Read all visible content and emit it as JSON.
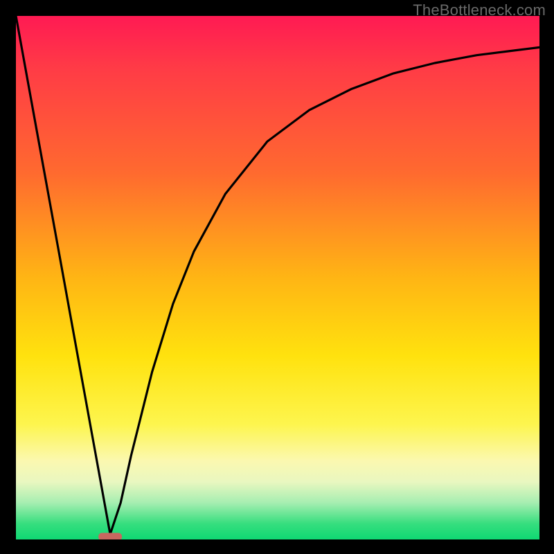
{
  "watermark": "TheBottleneck.com",
  "chart_data": {
    "type": "line",
    "title": "",
    "xlabel": "",
    "ylabel": "",
    "xlim": [
      0,
      100
    ],
    "ylim": [
      0,
      100
    ],
    "curve": {
      "description": "V-shaped curve: steep linear descent from top-left to a minimum near x≈18, then a concave-up rise approaching the top-right asymptotically",
      "x": [
        0,
        4,
        8,
        12,
        16,
        18,
        20,
        22,
        26,
        30,
        34,
        40,
        48,
        56,
        64,
        72,
        80,
        88,
        96,
        100
      ],
      "y": [
        100,
        78,
        56,
        34,
        12,
        1,
        7,
        16,
        32,
        45,
        55,
        66,
        76,
        82,
        86,
        89,
        91,
        92.5,
        93.5,
        94
      ]
    },
    "minimum_marker": {
      "shape": "rounded-dash",
      "x": 18,
      "y": 0.6,
      "color": "#c8675f"
    },
    "background_gradient": {
      "direction": "top-to-bottom",
      "stops": [
        {
          "pos": 0.0,
          "color": "#ff1a53"
        },
        {
          "pos": 0.3,
          "color": "#ff6a2f"
        },
        {
          "pos": 0.5,
          "color": "#ffb514"
        },
        {
          "pos": 0.78,
          "color": "#fdf54e"
        },
        {
          "pos": 0.93,
          "color": "#a6eeb1"
        },
        {
          "pos": 1.0,
          "color": "#0fd873"
        }
      ]
    }
  }
}
